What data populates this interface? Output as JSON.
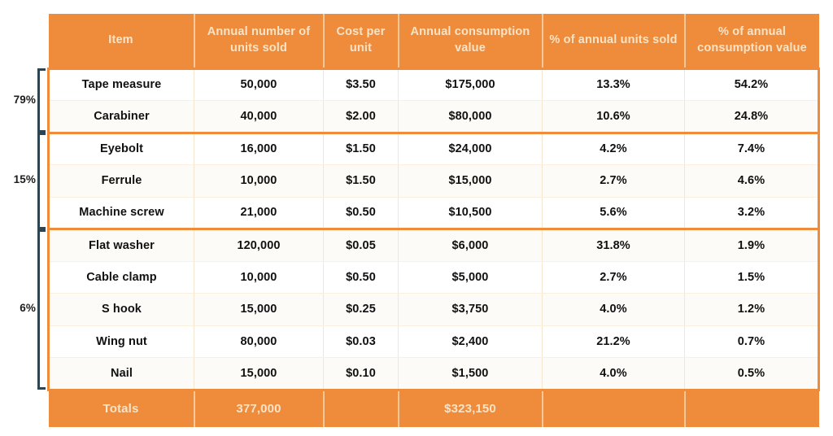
{
  "table": {
    "name": "abc-inventory-analysis-table",
    "headers": [
      "Item",
      "Annual number of units sold",
      "Cost per unit",
      "Annual consumption value",
      "% of annual units sold",
      "% of annual consumption value"
    ],
    "rows": [
      {
        "item": "Tape measure",
        "units": "50,000",
        "cost": "$3.50",
        "value": "$175,000",
        "pct_units": "13.3%",
        "pct_value": "54.2%"
      },
      {
        "item": "Carabiner",
        "units": "40,000",
        "cost": "$2.00",
        "value": "$80,000",
        "pct_units": "10.6%",
        "pct_value": "24.8%"
      },
      {
        "item": "Eyebolt",
        "units": "16,000",
        "cost": "$1.50",
        "value": "$24,000",
        "pct_units": "4.2%",
        "pct_value": "7.4%"
      },
      {
        "item": "Ferrule",
        "units": "10,000",
        "cost": "$1.50",
        "value": "$15,000",
        "pct_units": "2.7%",
        "pct_value": "4.6%"
      },
      {
        "item": "Machine screw",
        "units": "21,000",
        "cost": "$0.50",
        "value": "$10,500",
        "pct_units": "5.6%",
        "pct_value": "3.2%"
      },
      {
        "item": "Flat washer",
        "units": "120,000",
        "cost": "$0.05",
        "value": "$6,000",
        "pct_units": "31.8%",
        "pct_value": "1.9%"
      },
      {
        "item": "Cable clamp",
        "units": "10,000",
        "cost": "$0.50",
        "value": "$5,000",
        "pct_units": "2.7%",
        "pct_value": "1.5%"
      },
      {
        "item": "S hook",
        "units": "15,000",
        "cost": "$0.25",
        "value": "$3,750",
        "pct_units": "4.0%",
        "pct_value": "1.2%"
      },
      {
        "item": "Wing nut",
        "units": "80,000",
        "cost": "$0.03",
        "value": "$2,400",
        "pct_units": "21.2%",
        "pct_value": "0.7%"
      },
      {
        "item": "Nail",
        "units": "15,000",
        "cost": "$0.10",
        "value": "$1,500",
        "pct_units": "4.0%",
        "pct_value": "0.5%"
      }
    ],
    "totals": {
      "label": "Totals",
      "units": "377,000",
      "cost": "",
      "value": "$323,150",
      "pct_units": "",
      "pct_value": ""
    }
  },
  "brackets": [
    {
      "label": "79%",
      "first_row": 0,
      "last_row": 1
    },
    {
      "label": "15%",
      "first_row": 2,
      "last_row": 4
    },
    {
      "label": "6%",
      "first_row": 5,
      "last_row": 9
    }
  ],
  "colors": {
    "accent_orange": "#ee8c3c",
    "header_text": "#fbe3c6",
    "bracket": "#2d4550",
    "row_divider": "#fbf0dd",
    "body_text": "#111111",
    "background": "#ffffff"
  },
  "chart_data": {
    "type": "table",
    "title": "ABC inventory analysis",
    "columns": [
      "Item",
      "Annual number of units sold",
      "Cost per unit",
      "Annual consumption value",
      "% of annual units sold",
      "% of annual consumption value"
    ],
    "rows": [
      [
        "Tape measure",
        50000,
        3.5,
        175000,
        13.3,
        54.2
      ],
      [
        "Carabiner",
        40000,
        2.0,
        80000,
        10.6,
        24.8
      ],
      [
        "Eyebolt",
        16000,
        1.5,
        24000,
        4.2,
        7.4
      ],
      [
        "Ferrule",
        10000,
        1.5,
        15000,
        2.7,
        4.6
      ],
      [
        "Machine screw",
        21000,
        0.5,
        10500,
        5.6,
        3.2
      ],
      [
        "Flat washer",
        120000,
        0.05,
        6000,
        31.8,
        1.9
      ],
      [
        "Cable clamp",
        10000,
        0.5,
        5000,
        2.7,
        1.5
      ],
      [
        "S hook",
        15000,
        0.25,
        3750,
        4.0,
        1.2
      ],
      [
        "Wing nut",
        80000,
        0.03,
        2400,
        21.2,
        0.7
      ],
      [
        "Nail",
        15000,
        0.1,
        1500,
        4.0,
        0.5
      ]
    ],
    "totals": {
      "units": 377000,
      "consumption_value": 323150
    },
    "groups": [
      {
        "label": "79%",
        "items": [
          "Tape measure",
          "Carabiner"
        ]
      },
      {
        "label": "15%",
        "items": [
          "Eyebolt",
          "Ferrule",
          "Machine screw"
        ]
      },
      {
        "label": "6%",
        "items": [
          "Flat washer",
          "Cable clamp",
          "S hook",
          "Wing nut",
          "Nail"
        ]
      }
    ]
  }
}
